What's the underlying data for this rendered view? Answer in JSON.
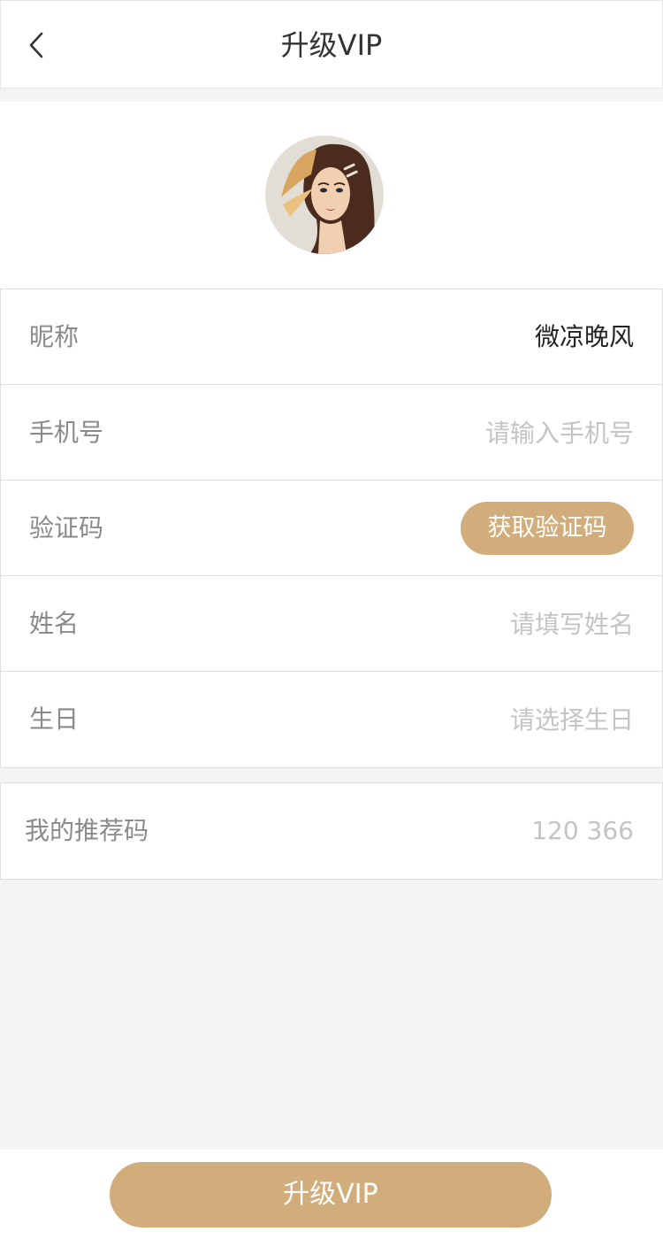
{
  "header": {
    "title": "升级VIP",
    "back_icon": "chevron-left-icon"
  },
  "profile": {
    "avatar_icon": "user-avatar-illustration"
  },
  "form": {
    "nickname": {
      "label": "昵称",
      "value": "微凉晚风"
    },
    "phone": {
      "label": "手机号",
      "placeholder": "请输入手机号",
      "value": ""
    },
    "code": {
      "label": "验证码",
      "button_label": "获取验证码"
    },
    "name": {
      "label": "姓名",
      "placeholder": "请填写姓名",
      "value": ""
    },
    "birthday": {
      "label": "生日",
      "placeholder": "请选择生日",
      "value": ""
    }
  },
  "referral": {
    "label": "我的推荐码",
    "value": "120 366"
  },
  "footer": {
    "submit_label": "升级VIP"
  },
  "colors": {
    "accent": "#d2ad7c",
    "background": "#f4f4f4",
    "label_text": "#8a8a8a",
    "placeholder_text": "#c4c4c4"
  }
}
